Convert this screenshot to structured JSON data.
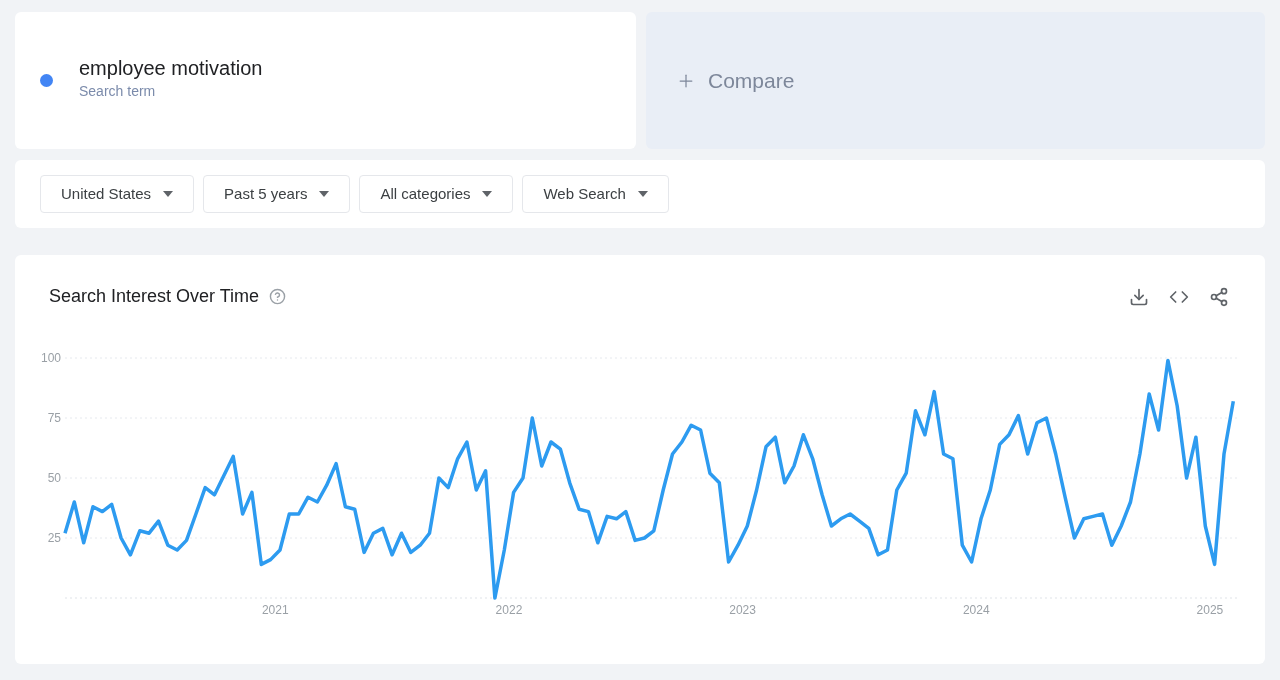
{
  "search_term": {
    "term": "employee motivation",
    "subtitle": "Search term",
    "color": "#4285f4"
  },
  "compare": {
    "label": "Compare"
  },
  "filters": [
    {
      "label": "United States"
    },
    {
      "label": "Past 5 years"
    },
    {
      "label": "All categories"
    },
    {
      "label": "Web Search"
    }
  ],
  "interest_panel": {
    "title": "Search Interest Over Time",
    "chart_data": {
      "type": "line",
      "x": [
        2020.1,
        2020.14,
        2020.18,
        2020.22,
        2020.26,
        2020.3,
        2020.34,
        2020.38,
        2020.42,
        2020.46,
        2020.5,
        2020.54,
        2020.58,
        2020.62,
        2020.66,
        2020.7,
        2020.74,
        2020.78,
        2020.82,
        2020.86,
        2020.9,
        2020.94,
        2020.98,
        2021.02,
        2021.06,
        2021.1,
        2021.14,
        2021.18,
        2021.22,
        2021.26,
        2021.3,
        2021.34,
        2021.38,
        2021.42,
        2021.46,
        2021.5,
        2021.54,
        2021.58,
        2021.62,
        2021.66,
        2021.7,
        2021.74,
        2021.78,
        2021.82,
        2021.86,
        2021.9,
        2021.94,
        2021.98,
        2022.02,
        2022.06,
        2022.1,
        2022.14,
        2022.18,
        2022.22,
        2022.26,
        2022.3,
        2022.34,
        2022.38,
        2022.42,
        2022.46,
        2022.5,
        2022.54,
        2022.58,
        2022.62,
        2022.66,
        2022.7,
        2022.74,
        2022.78,
        2022.82,
        2022.86,
        2022.9,
        2022.94,
        2022.98,
        2023.02,
        2023.06,
        2023.1,
        2023.14,
        2023.18,
        2023.22,
        2023.26,
        2023.3,
        2023.34,
        2023.38,
        2023.42,
        2023.46,
        2023.5,
        2023.54,
        2023.58,
        2023.62,
        2023.66,
        2023.7,
        2023.74,
        2023.78,
        2023.82,
        2023.86,
        2023.9,
        2023.94,
        2023.98,
        2024.02,
        2024.06,
        2024.1,
        2024.14,
        2024.18,
        2024.22,
        2024.26,
        2024.3,
        2024.34,
        2024.38,
        2024.42,
        2024.46,
        2024.5,
        2024.54,
        2024.58,
        2024.62,
        2024.66,
        2024.7,
        2024.74,
        2024.78,
        2024.82,
        2024.86,
        2024.9,
        2024.94,
        2024.98,
        2025.02,
        2025.06,
        2025.1
      ],
      "series": [
        {
          "color": "#2d9bf0",
          "values": [
            27,
            40,
            23,
            38,
            36,
            39,
            25,
            18,
            28,
            27,
            32,
            22,
            20,
            24,
            35,
            46,
            43,
            51,
            59,
            35,
            44,
            14,
            16,
            20,
            35,
            35,
            42,
            40,
            47,
            56,
            38,
            37,
            19,
            27,
            29,
            18,
            27,
            19,
            22,
            27,
            50,
            46,
            58,
            65,
            45,
            53,
            0,
            20,
            44,
            50,
            75,
            55,
            65,
            62,
            48,
            37,
            36,
            23,
            34,
            33,
            36,
            24,
            25,
            28,
            45,
            60,
            65,
            72,
            70,
            52,
            48,
            15,
            22,
            30,
            45,
            63,
            67,
            48,
            55,
            68,
            58,
            43,
            30,
            33,
            35,
            32,
            29,
            18,
            20,
            45,
            52,
            78,
            68,
            86,
            60,
            58,
            22,
            15,
            33,
            45,
            64,
            68,
            76,
            60,
            73,
            75,
            60,
            42,
            25,
            33,
            34,
            35,
            22,
            30,
            40,
            60,
            85,
            70,
            99,
            80,
            50,
            67,
            30,
            14,
            60,
            82
          ]
        }
      ],
      "xlim": [
        2020.1,
        2025.12
      ],
      "ylim": [
        0,
        100
      ],
      "grid": true,
      "xticks": [
        {
          "value": 2021,
          "label": "2021"
        },
        {
          "value": 2022,
          "label": "2022"
        },
        {
          "value": 2023,
          "label": "2023"
        },
        {
          "value": 2024,
          "label": "2024"
        },
        {
          "value": 2025,
          "label": "2025"
        }
      ],
      "yticks": [
        25,
        50,
        75,
        100
      ]
    }
  }
}
